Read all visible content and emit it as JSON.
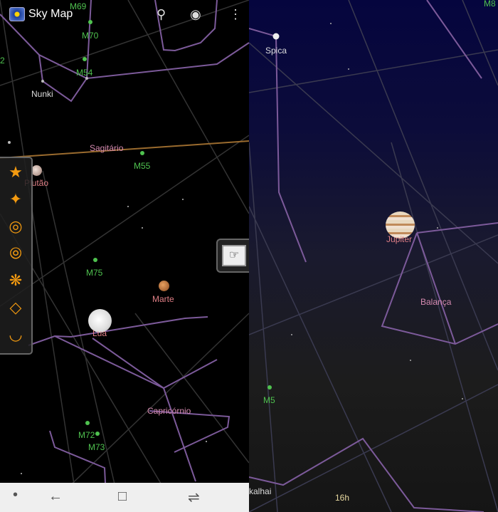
{
  "app": {
    "title": "Sky Map"
  },
  "toolbar": {
    "search_icon": "search-icon",
    "eye_icon": "eye-icon",
    "menu_icon": "more-vert-icon"
  },
  "left_labels": {
    "m69": "M69",
    "m70": "M70",
    "m54": "M54",
    "nunki": "Nunki",
    "edge2": "2",
    "sagitario": "Sagitário",
    "m55": "M55",
    "plutao": "Plutão",
    "m75": "M75",
    "marte": "Marte",
    "lua": "Lua",
    "capricornio": "Capricórnio",
    "m72": "M72",
    "m73": "M73"
  },
  "right_labels": {
    "spica": "Spica",
    "m8": "M8",
    "jupiter": "Júpiter",
    "balanca": "Balança",
    "m5": "M5",
    "kalhai": "kalhai",
    "ra": "16h"
  },
  "layers": [
    "star-layer",
    "constellation-layer",
    "messier-layer",
    "planet-layer",
    "meteor-layer",
    "grid-layer",
    "horizon-layer"
  ],
  "colors": {
    "accent": "#f39a10",
    "messier": "#4fc24f",
    "constellation": "#7c5a9a",
    "planet_label": "#e07f86"
  }
}
